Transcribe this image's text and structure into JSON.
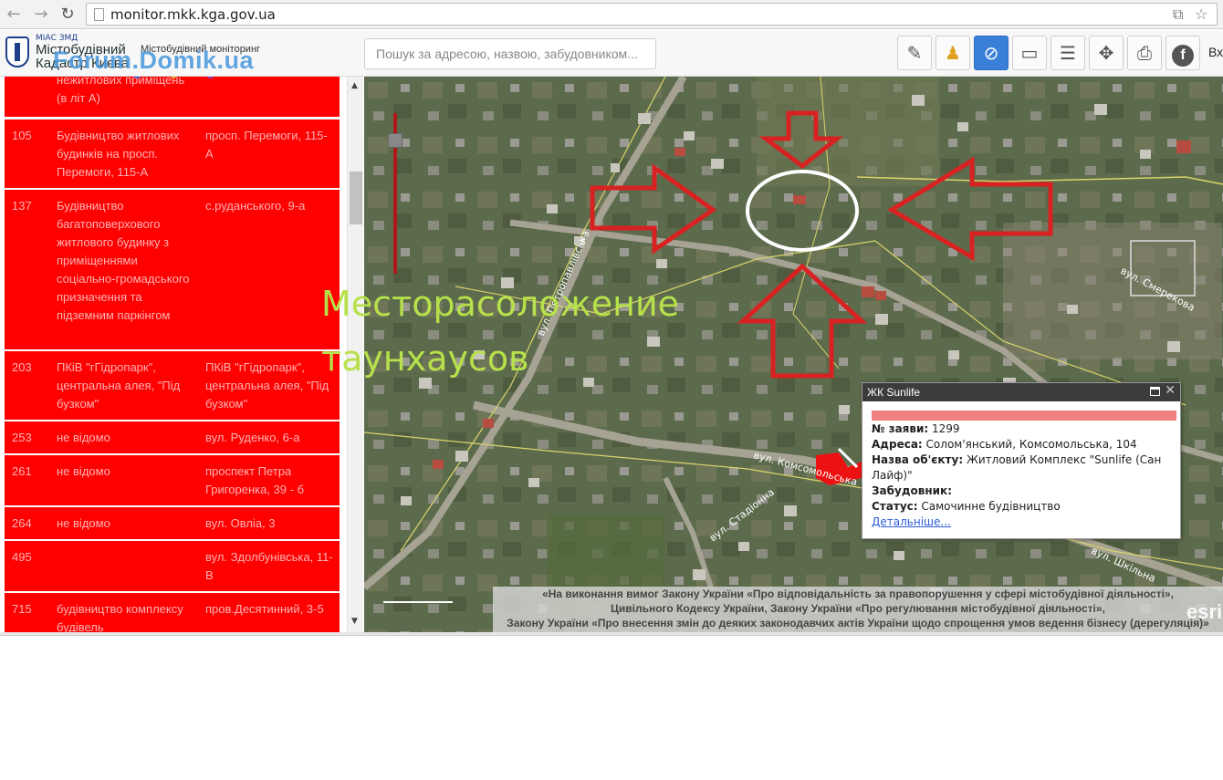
{
  "browser": {
    "url": "monitor.mkk.kga.gov.ua"
  },
  "header": {
    "logo_small": "МІАС ЗМД",
    "logo_line1": "Містобудівний",
    "logo_line2": "Кадастр Києва",
    "logo_subtitle": "Містобудівний моніторинг",
    "watermark": "Forum.Domik.ua",
    "search_placeholder": "Пошук за адресою, назвою, забудовником...",
    "login_label": "Вх",
    "tools": [
      "edit-icon",
      "pegman-icon",
      "compass-icon",
      "ruler-icon",
      "layers-icon",
      "pan-icon",
      "print-icon",
      "facebook-icon"
    ]
  },
  "list": {
    "partial_top": "нежитлових приміщень (в літ А)",
    "rows": [
      {
        "id": "105",
        "name": "Будівництво житлових будинків на просп. Перемоги, 115-А",
        "address": "просп. Перемоги, 115-А"
      },
      {
        "id": "137",
        "name": "Будівництво багатоповерхового житлового будинку з приміщеннями соціально-громадського призначення та підземним паркінгом",
        "address": "с.руданського, 9-а"
      },
      {
        "id": "203",
        "name": "ПКіВ \"гГідропарк\", центральна алея, \"Під бузком\"",
        "address": "ПКіВ \"гГідропарк\", центральна алея, \"Під бузком\""
      },
      {
        "id": "253",
        "name": "не відомо",
        "address": "вул. Руденко, 6-а"
      },
      {
        "id": "261",
        "name": "не відомо",
        "address": "проспект Петра Григоренка, 39 - б"
      },
      {
        "id": "264",
        "name": "не відомо",
        "address": "вул. Овліа, 3"
      },
      {
        "id": "495",
        "name": "",
        "address": "вул. Здолбунівська, 11-В"
      },
      {
        "id": "715",
        "name": "будівництво комплексу будівель",
        "address": "пров.Десятинний, 3-5"
      }
    ]
  },
  "map": {
    "caption": "Месторасоложение таунхаусов",
    "streets": [
      "вул. Петропавлівська",
      "вул. Смерекова",
      "вул. Комсомольська",
      "вул. Стадіонна",
      "вул. Шкільна"
    ],
    "popup": {
      "title": "ЖК Sunlife",
      "app_label": "№ заяви:",
      "app_value": "1299",
      "address_label": "Адреса:",
      "address_value": "Солом'янський, Комсомольська, 104",
      "object_label": "Назва об'єкту:",
      "object_value": "Житловий Комплекс \"Sunlife (Сан Лайф)\"",
      "developer_label": "Забудовник:",
      "developer_value": "",
      "status_label": "Статус:",
      "status_value": "Самочинне будівництво",
      "details_link": "Детальніше..."
    },
    "legal_lines": [
      "«На виконання вимог Закону України «Про відповідальність за правопорушення у сфері містобудівної діяльності»,",
      "Цивільного Кодексу України, Закону України «Про регулювання містобудівної діяльності»,",
      "Закону України «Про внесення змін до деяких законодавчих актів України щодо спрощення умов ведення бізнесу (дерегуляція)»"
    ],
    "esri": "esri"
  },
  "colors": {
    "row_bg": "#ff0000",
    "row_text": "#ffb3b3",
    "popup_bar": "#f08080",
    "arrow": "#d82222",
    "caption": "#b7e14a"
  }
}
